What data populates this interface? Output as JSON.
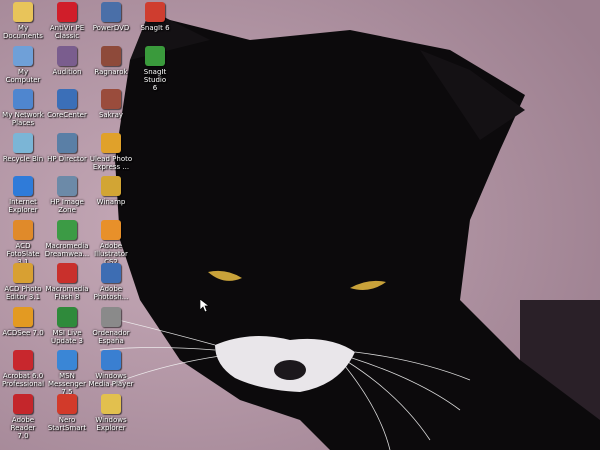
{
  "desktop": {
    "icons": [
      {
        "label": "My Documents",
        "icon": "folder-documents-icon",
        "color": "#e8c45a"
      },
      {
        "label": "My Computer",
        "icon": "computer-icon",
        "color": "#6fa0d8"
      },
      {
        "label": "My Network\nPlaces",
        "icon": "network-icon",
        "color": "#4f86cf"
      },
      {
        "label": "Recycle Bin",
        "icon": "recycle-bin-icon",
        "color": "#7bb5d6"
      },
      {
        "label": "Internet\nExplorer",
        "icon": "internet-explorer-icon",
        "color": "#2f7bd9"
      },
      {
        "label": "ACD FotoSlate\n3.1",
        "icon": "acd-fotoslate-icon",
        "color": "#e08a2a"
      },
      {
        "label": "ACD Photo\nEditor 3.1",
        "icon": "acd-photo-editor-icon",
        "color": "#d8a032"
      },
      {
        "label": "ACDSee 7.0",
        "icon": "acdsee-icon",
        "color": "#e39a22"
      },
      {
        "label": "Acrobat 6.0\nProfessional",
        "icon": "acrobat-icon",
        "color": "#c8272d"
      },
      {
        "label": "Adobe Reader\n7.0",
        "icon": "adobe-reader-icon",
        "color": "#c4262b"
      },
      {
        "label": "AntiVir PE\nClassic",
        "icon": "antivir-icon",
        "color": "#d01e2a"
      },
      {
        "label": "Audition",
        "icon": "audition-icon",
        "color": "#7a5d8e"
      },
      {
        "label": "CoreCenter",
        "icon": "corecenter-icon",
        "color": "#3b6fb8"
      },
      {
        "label": "HP Director",
        "icon": "hp-director-icon",
        "color": "#5a7fa6"
      },
      {
        "label": "HP Image\nZone",
        "icon": "hp-image-zone-icon",
        "color": "#6c8aa8"
      },
      {
        "label": "Macromedia\nDreamwea...",
        "icon": "dreamweaver-icon",
        "color": "#3c9b45"
      },
      {
        "label": "Macromedia\nFlash 8",
        "icon": "flash-icon",
        "color": "#c9302c"
      },
      {
        "label": "MSI Live\nUpdate 3",
        "icon": "msi-live-update-icon",
        "color": "#2f8a3b"
      },
      {
        "label": "MSN\nMessenger 7.5",
        "icon": "msn-messenger-icon",
        "color": "#3a86d6"
      },
      {
        "label": "Nero\nStartSmart",
        "icon": "nero-icon",
        "color": "#d23a2a"
      },
      {
        "label": "PowerDVD",
        "icon": "powerdvd-icon",
        "color": "#4a6fa8"
      },
      {
        "label": "Ragnarok",
        "icon": "ragnarok-icon",
        "color": "#8e4a3a"
      },
      {
        "label": "Sakray",
        "icon": "sakray-icon",
        "color": "#9a4c3c"
      },
      {
        "label": "Ulead Photo\nExpress ...",
        "icon": "ulead-photo-express-icon",
        "color": "#e0a12a"
      },
      {
        "label": "Winamp",
        "icon": "winamp-icon",
        "color": "#d2a534"
      },
      {
        "label": "Adobe\nIllustrator CS2",
        "icon": "illustrator-icon",
        "color": "#e8902a"
      },
      {
        "label": "Adobe\nPhotosh...",
        "icon": "photoshop-icon",
        "color": "#3d6db3"
      },
      {
        "label": "Ordenador\nEspaña",
        "icon": "ordenador-icon",
        "color": "#8a8a8a"
      },
      {
        "label": "Windows\nMedia Player",
        "icon": "media-player-icon",
        "color": "#3a7fd1"
      },
      {
        "label": "Windows\nExplorer",
        "icon": "windows-explorer-icon",
        "color": "#e2c04e"
      },
      {
        "label": "SnagIt 6",
        "icon": "snagit-icon",
        "color": "#cf3d2f"
      },
      {
        "label": "SnagIt Studio\n6",
        "icon": "snagit-studio-icon",
        "color": "#3a9a3c"
      }
    ]
  }
}
